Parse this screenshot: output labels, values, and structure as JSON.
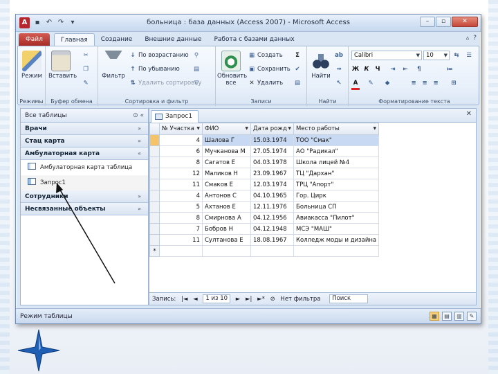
{
  "title": "больница : база данных (Access 2007) - Microsoft Access",
  "app_icon": "A",
  "window_buttons": [
    "–",
    "▫",
    "✕"
  ],
  "file_tab": "Файл",
  "tabs": [
    "Главная",
    "Создание",
    "Внешние данные",
    "Работа с базами данных"
  ],
  "ribbon": {
    "views": {
      "label": "Режим",
      "group": "Режимы"
    },
    "clipboard": {
      "paste": "Вставить",
      "group": "Буфер обмена"
    },
    "sort": {
      "filter": "Фильтр",
      "asc": "По возрастанию",
      "desc": "По убыванию",
      "remove": "Удалить сортировку",
      "group": "Сортировка и фильтр"
    },
    "records": {
      "refresh": "Обновить",
      "refresh2": "все",
      "create": "Создать",
      "save": "Сохранить",
      "delete": "Удалить",
      "sum": "Σ",
      "group": "Записи"
    },
    "find": {
      "label": "Найти",
      "group": "Найти"
    },
    "font": {
      "name": "Calibri",
      "size": "10",
      "bold": "Ж",
      "italic": "К",
      "underline": "Ч",
      "group": "Форматирование текста"
    }
  },
  "nav": {
    "header": "Все таблицы",
    "groups": [
      {
        "label": "Врачи",
        "chevron": "»"
      },
      {
        "label": "Стац карта",
        "chevron": "»"
      },
      {
        "label": "Амбулаторная карта",
        "chevron": "«"
      }
    ],
    "items": [
      {
        "label": "Амбулаторная карта таблица"
      },
      {
        "label": "Запрос1"
      }
    ],
    "groups2": [
      {
        "label": "Сотрудники",
        "chevron": "»"
      },
      {
        "label": "Несвязанные объекты",
        "chevron": "»"
      }
    ]
  },
  "doc_tab": "Запрос1",
  "table": {
    "columns": [
      "№ Участка",
      "ФИО",
      "Дата рожд",
      "Место работы"
    ],
    "rows": [
      [
        "4",
        "Шалова Г",
        "15.03.1974",
        "ТОО \"Смак\""
      ],
      [
        "6",
        "Мучканова М",
        "27.05.1974",
        "АО \"Радикал\""
      ],
      [
        "8",
        "Сагатов Е",
        "04.03.1978",
        "Школа лицей №4"
      ],
      [
        "12",
        "Маликов Н",
        "23.09.1967",
        "ТЦ \"Дархан\""
      ],
      [
        "11",
        "Смаков Е",
        "12.03.1974",
        "ТРЦ \"Апорт\""
      ],
      [
        "4",
        "Антонов С",
        "04.10.1965",
        "Гор. Цирк"
      ],
      [
        "5",
        "Ахтанов Е",
        "12.11.1976",
        "Больница СП"
      ],
      [
        "8",
        "Смирнова А",
        "04.12.1956",
        "Авиакасса \"Пилот\""
      ],
      [
        "7",
        "Бобров Н",
        "04.12.1948",
        "МСЭ \"МАШ\""
      ],
      [
        "11",
        "Султанова Е",
        "18.08.1967",
        "Колледж моды и дизайна"
      ]
    ],
    "new_row_marker": "*"
  },
  "record_nav": {
    "label": "Запись:",
    "position": "1 из 10",
    "filter": "Нет фильтра",
    "search": "Поиск"
  },
  "status": "Режим таблицы",
  "colors": {
    "accent": "#b6262f",
    "ribbon": "#dbe6f4",
    "selected_row": "#c8daf3",
    "star": "#1e5fb4"
  },
  "icons": [
    "search-icon",
    "arrow-icon",
    "star-icon"
  ]
}
